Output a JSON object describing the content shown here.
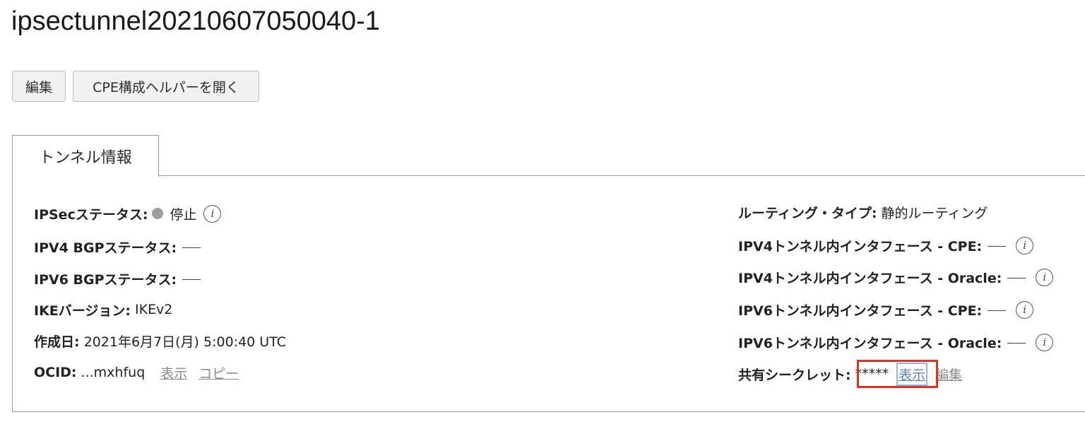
{
  "page": {
    "title": "ipsectunnel20210607050040-1"
  },
  "actions": {
    "edit_label": "編集",
    "cpe_helper_label": "CPE構成ヘルパーを開く"
  },
  "tabs": [
    {
      "label": "トンネル情報"
    }
  ],
  "left": {
    "ipsec_status": {
      "label": "IPSecステータス:",
      "value": "停止",
      "status_color": "#9e9e9e"
    },
    "ipv4_bgp": {
      "label": "IPV4 BGPステータス:"
    },
    "ipv6_bgp": {
      "label": "IPV6 BGPステータス:"
    },
    "ike_version": {
      "label": "IKEバージョン:",
      "value": "IKEv2"
    },
    "created": {
      "label": "作成日:",
      "value": "2021年6月7日(月) 5:00:40 UTC"
    },
    "ocid": {
      "label": "OCID:",
      "value": "...mxhfuq",
      "show_label": "表示",
      "copy_label": "コピー"
    }
  },
  "right": {
    "routing_type": {
      "label": "ルーティング・タイプ:",
      "value": "静的ルーティング"
    },
    "ipv4_cpe": {
      "label": "IPV4トンネル内インタフェース - CPE:"
    },
    "ipv4_oracle": {
      "label": "IPV4トンネル内インタフェース - Oracle:"
    },
    "ipv6_cpe": {
      "label": "IPV6トンネル内インタフェース - CPE:"
    },
    "ipv6_oracle": {
      "label": "IPV6トンネル内インタフェース - Oracle:"
    },
    "shared_secret": {
      "label": "共有シークレット:",
      "value": "*****",
      "show_label": "表示",
      "edit_label": "編集"
    }
  },
  "icons": {
    "info": "info-icon",
    "info_glyph": "i"
  },
  "colors": {
    "highlight_box": "#e0301e"
  }
}
